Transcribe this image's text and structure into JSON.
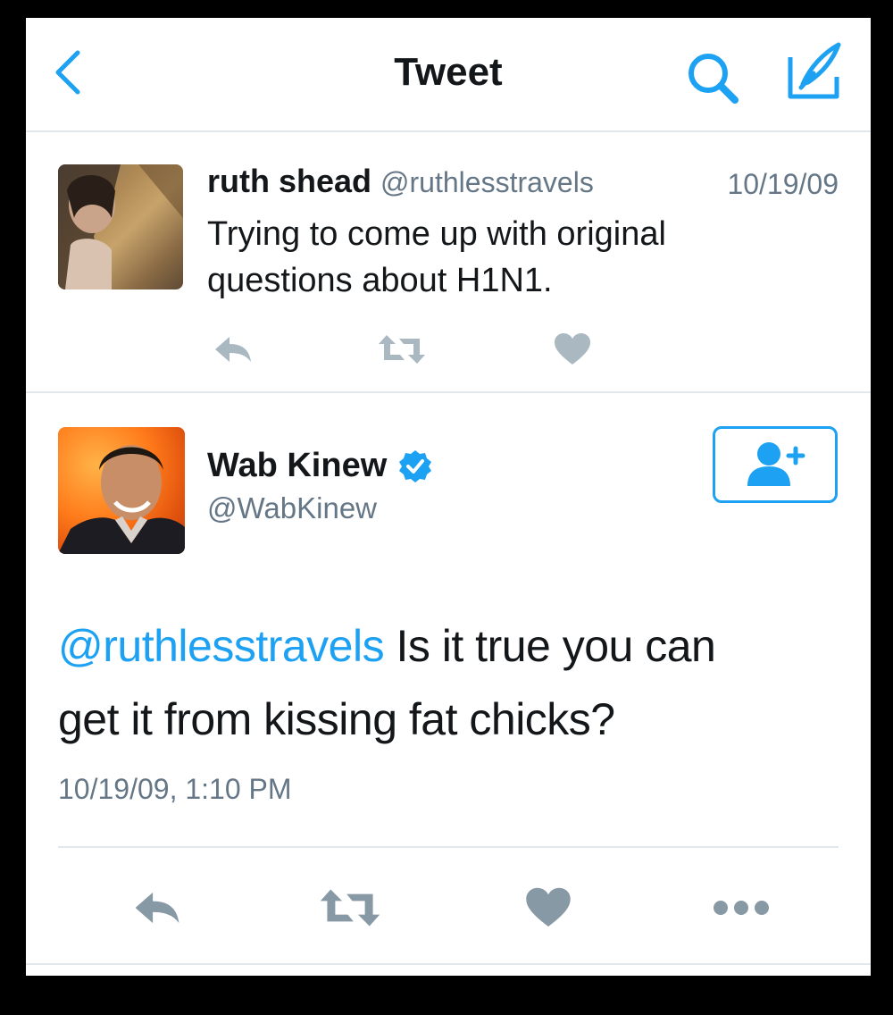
{
  "header": {
    "title": "Tweet",
    "back_icon": "chevron-left-icon",
    "search_icon": "search-icon",
    "compose_icon": "compose-icon"
  },
  "tweet_quoted": {
    "name": "ruth shead",
    "handle": "@ruthlesstravels",
    "date": "10/19/09",
    "text_line1": "Trying to come up with original",
    "text_line2": "questions about H1N1."
  },
  "tweet_main": {
    "name": "Wab Kinew",
    "verified": true,
    "handle": "@WabKinew",
    "mention": "@ruthlesstravels",
    "text_line1_rest": " Is it true you can",
    "text_line2": "get it from kissing fat chicks?",
    "timestamp": "10/19/09, 1:10 PM"
  },
  "colors": {
    "accent": "#1da1f2",
    "icon_gray": "#8899a6",
    "text": "#14171a",
    "secondary": "#657786"
  }
}
